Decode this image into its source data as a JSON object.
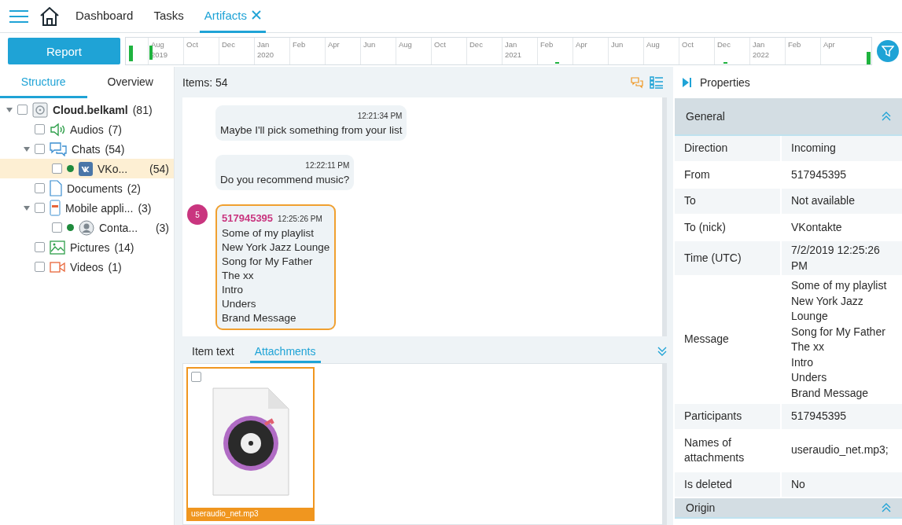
{
  "nav": {
    "items": [
      {
        "label": "Dashboard",
        "selected": false
      },
      {
        "label": "Tasks",
        "selected": false
      },
      {
        "label": "Artifacts",
        "selected": true
      }
    ]
  },
  "toolbar": {
    "report_button": "Report"
  },
  "timeline": {
    "ticks": [
      {
        "label": "Aug",
        "year": "2019"
      },
      {
        "label": "Oct"
      },
      {
        "label": "Dec"
      },
      {
        "label": "Jan",
        "year": "2020"
      },
      {
        "label": "Feb"
      },
      {
        "label": "Apr"
      },
      {
        "label": "Jun"
      },
      {
        "label": "Aug"
      },
      {
        "label": "Oct"
      },
      {
        "label": "Dec"
      },
      {
        "label": "Jan",
        "year": "2021"
      },
      {
        "label": "Feb"
      },
      {
        "label": "Apr"
      },
      {
        "label": "Jun"
      },
      {
        "label": "Aug"
      },
      {
        "label": "Oct"
      },
      {
        "label": "Dec"
      },
      {
        "label": "Jan",
        "year": "2022"
      },
      {
        "label": "Feb"
      },
      {
        "label": "Apr"
      }
    ]
  },
  "left_tabs": [
    {
      "label": "Structure",
      "selected": true
    },
    {
      "label": "Overview",
      "selected": false
    }
  ],
  "tree": [
    {
      "label": "Cloud.belkaml",
      "count": "(81)",
      "kind": "drive",
      "checked": false,
      "expanded": true,
      "selected": false,
      "children": [
        {
          "label": "Audios",
          "count": "(7)",
          "kind": "audio",
          "checked": false,
          "selected": false
        },
        {
          "label": "Chats",
          "count": "(54)",
          "kind": "chat",
          "checked": false,
          "expanded": true,
          "selected": false,
          "children": [
            {
              "label": "VKo...",
              "count": "(54)",
              "kind": "vk",
              "checked": false,
              "selected": true,
              "color": "#1f8a3c"
            }
          ]
        },
        {
          "label": "Documents",
          "count": "(2)",
          "kind": "document",
          "checked": false,
          "selected": false
        },
        {
          "label": "Mobile appli...",
          "count": "(3)",
          "kind": "app",
          "checked": false,
          "expanded": true,
          "selected": false,
          "children": [
            {
              "label": "Conta...",
              "count": "(3)",
              "kind": "contact",
              "checked": false,
              "selected": false,
              "color": "#1f8a3c"
            }
          ]
        },
        {
          "label": "Pictures",
          "count": "(14)",
          "kind": "picture",
          "checked": false,
          "selected": false
        },
        {
          "label": "Videos",
          "count": "(1)",
          "kind": "video",
          "checked": false,
          "selected": false
        }
      ]
    }
  ],
  "items_count": "Items: 54",
  "messages": [
    {
      "time": "12:21:34 PM",
      "lines": [
        "Maybe I'll pick something from your list"
      ],
      "selected": false
    },
    {
      "time": "12:22:11 PM",
      "lines": [
        "Do you recommend music?"
      ],
      "selected": false
    },
    {
      "badge": "5",
      "sender": "517945395",
      "time": "12:25:26 PM",
      "lines": [
        "Some of my playlist",
        "New York Jazz Lounge",
        "Song for My Father",
        "The xx",
        "Intro",
        "Unders",
        "Brand Message"
      ],
      "selected": true
    }
  ],
  "bottom_tabs": [
    {
      "label": "Item text",
      "selected": false
    },
    {
      "label": "Attachments",
      "selected": true
    }
  ],
  "attachments": [
    {
      "name": "useraudio_net.mp3",
      "checked": false,
      "selected": true
    }
  ],
  "properties": {
    "title": "Properties",
    "sections": [
      {
        "title": "General",
        "expanded": true,
        "rows": [
          {
            "label": "Direction",
            "value": [
              "Incoming"
            ]
          },
          {
            "label": "From",
            "value": [
              "517945395"
            ]
          },
          {
            "label": "To",
            "value": [
              "Not available"
            ]
          },
          {
            "label": "To (nick)",
            "value": [
              "VKontakte"
            ]
          },
          {
            "label": "Time (UTC)",
            "value": [
              "7/2/2019 12:25:26 PM"
            ]
          },
          {
            "label": "Message",
            "value": [
              "Some of my playlist",
              "New York Jazz Lounge",
              "Song for My Father",
              "The xx",
              "Intro",
              "Unders",
              "Brand Message"
            ]
          },
          {
            "label": "Participants",
            "value": [
              "517945395"
            ]
          },
          {
            "label": "Names of attachments",
            "value": [
              "useraudio_net.mp3;"
            ]
          },
          {
            "label": "Is deleted",
            "value": [
              "No"
            ]
          }
        ]
      },
      {
        "title": "Origin",
        "expanded": true
      }
    ]
  }
}
